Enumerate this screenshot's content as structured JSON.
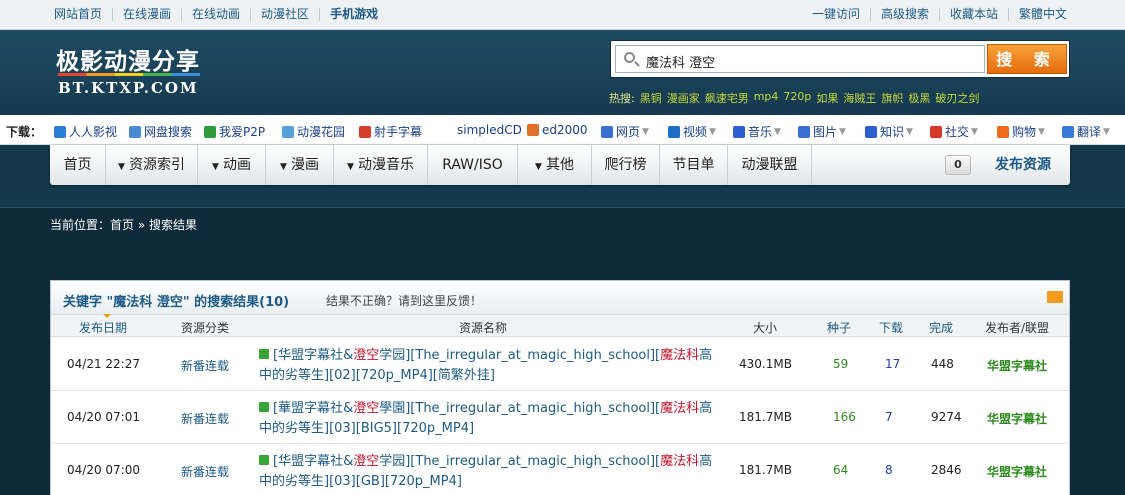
{
  "topbar": {
    "left_links": [
      "网站首页",
      "在线漫画",
      "在线动画",
      "动漫社区",
      "手机游戏"
    ],
    "right_links": [
      "一键访问",
      "高级搜索",
      "收藏本站",
      "繁體中文"
    ]
  },
  "header": {
    "logo_cn": "极影动漫分享",
    "logo_en": "BT.KTXP.COM",
    "search_value": "魔法科 澄空",
    "search_button": "搜 索",
    "hot_label": "热搜:",
    "hot_terms": [
      "黑铜",
      "漫画家",
      "飙速宅男",
      "mp4",
      "720p",
      "如果",
      "海贼王",
      "旗帜",
      "极黑",
      "破刃之剑"
    ]
  },
  "download_bar": {
    "label": "下载：",
    "items": [
      {
        "label": "人人影视",
        "icon": "renren-icon",
        "color": "#2c7fd6",
        "arrow": false
      },
      {
        "label": "网盘搜索",
        "icon": "cloud-search-icon",
        "color": "#4a8ad0",
        "arrow": false
      },
      {
        "label": "我爱P2P",
        "icon": "p2p-icon",
        "color": "#2e9b3a",
        "arrow": false
      },
      {
        "label": "动漫花园",
        "icon": "dmhy-icon",
        "color": "#58a0d8",
        "arrow": false
      },
      {
        "label": "射手字幕",
        "icon": "shooter-icon",
        "color": "#d43d2a",
        "arrow": false
      },
      {
        "label": "simpledCD",
        "icon": "",
        "color": "",
        "arrow": false
      },
      {
        "label": "ed2000",
        "icon": "ed2000-icon",
        "color": "#e0702a",
        "arrow": false
      },
      {
        "label": "网页",
        "icon": "google-web-icon",
        "color": "#3b6fd1",
        "arrow": true
      },
      {
        "label": "视频",
        "icon": "soku-icon",
        "color": "#1c6ec9",
        "arrow": true
      },
      {
        "label": "音乐",
        "icon": "baidu-music-icon",
        "color": "#2f5fcf",
        "arrow": true
      },
      {
        "label": "图片",
        "icon": "google-image-icon",
        "color": "#3b6fd1",
        "arrow": true
      },
      {
        "label": "知识",
        "icon": "baidu-zhidao-icon",
        "color": "#2f5fcf",
        "arrow": true
      },
      {
        "label": "社交",
        "icon": "weibo-icon",
        "color": "#d8382c",
        "arrow": true
      },
      {
        "label": "购物",
        "icon": "taobao-icon",
        "color": "#ee6a1d",
        "arrow": true
      },
      {
        "label": "翻译",
        "icon": "translate-icon",
        "color": "#3a7bd5",
        "arrow": true
      }
    ]
  },
  "nav": {
    "items": [
      {
        "label": "首页",
        "dropdown": false
      },
      {
        "label": "资源索引",
        "dropdown": true
      },
      {
        "label": "动画",
        "dropdown": true
      },
      {
        "label": "漫画",
        "dropdown": true
      },
      {
        "label": "动漫音乐",
        "dropdown": true
      },
      {
        "label": "RAW/ISO",
        "dropdown": false
      },
      {
        "label": "其他",
        "dropdown": true
      },
      {
        "label": "爬行榜",
        "dropdown": false
      },
      {
        "label": "节目单",
        "dropdown": false
      },
      {
        "label": "动漫联盟",
        "dropdown": false
      }
    ],
    "counter": "0",
    "publish": "发布资源"
  },
  "breadcrumb": "当前位置：首页 » 搜索结果",
  "results": {
    "title": "关键字 \"魔法科 澄空\" 的搜索结果(10)",
    "feedback": "结果不正确？请到这里反馈！",
    "columns": [
      "发布日期",
      "资源分类",
      "资源名称",
      "大小",
      "种子",
      "下载",
      "完成",
      "发布者/联盟"
    ],
    "rows": [
      {
        "date": "04/21 22:27",
        "category": "新番连载",
        "name_parts": [
          "[华盟字幕社&",
          "澄空",
          "学园][The_irregular_at_magic_high_school][",
          "魔法科",
          "高中的劣等生][02][720p_MP4][简繁外挂]"
        ],
        "size": "430.1MB",
        "seeds": "59",
        "downloads": "17",
        "finished": "448",
        "publisher": "华盟字幕社"
      },
      {
        "date": "04/20 07:01",
        "category": "新番连载",
        "name_parts": [
          "[華盟字幕社&",
          "澄空",
          "學園][The_irregular_at_magic_high_school][",
          "魔法科",
          "高中的劣等生][03][BIG5][720p_MP4]"
        ],
        "size": "181.7MB",
        "seeds": "166",
        "downloads": "7",
        "finished": "9274",
        "publisher": "华盟字幕社"
      },
      {
        "date": "04/20 07:00",
        "category": "新番连载",
        "name_parts": [
          "[华盟字幕社&",
          "澄空",
          "学园][The_irregular_at_magic_high_school][",
          "魔法科",
          "高中的劣等生][03][GB][720p_MP4]"
        ],
        "size": "181.7MB",
        "seeds": "64",
        "downloads": "8",
        "finished": "2846",
        "publisher": "华盟字幕社"
      }
    ]
  }
}
